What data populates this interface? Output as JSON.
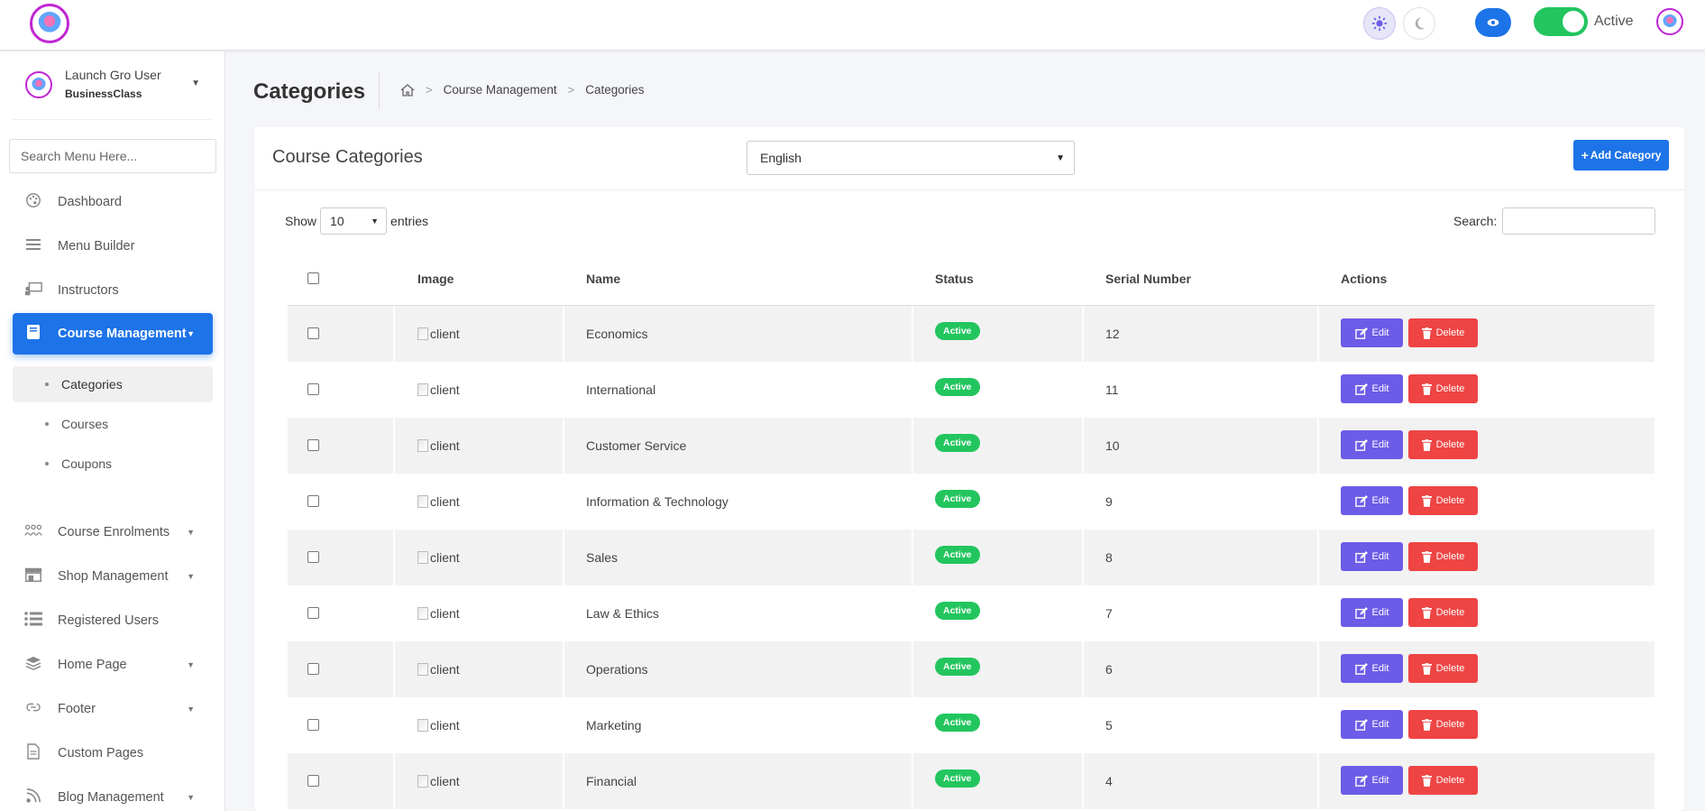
{
  "topbar": {
    "status_label": "Active",
    "icons": [
      "logo",
      "sun-icon",
      "moon-icon",
      "eye-icon",
      "toggle-switch",
      "avatar"
    ]
  },
  "sidebar": {
    "user_name": "Launch Gro User",
    "user_class": "BusinessClass",
    "search_placeholder": "Search Menu Here...",
    "items": [
      {
        "label": "Dashboard",
        "icon": "palette-icon"
      },
      {
        "label": "Menu Builder",
        "icon": "bars-icon"
      },
      {
        "label": "Instructors",
        "icon": "chalkboard-teacher-icon"
      },
      {
        "label": "Course Management",
        "icon": "book-icon"
      },
      {
        "label": "Course Enrolments",
        "icon": "users-icon"
      },
      {
        "label": "Shop Management",
        "icon": "store-icon"
      },
      {
        "label": "Registered Users",
        "icon": "list-icon"
      },
      {
        "label": "Home Page",
        "icon": "layers-icon"
      },
      {
        "label": "Footer",
        "icon": "link-icon"
      },
      {
        "label": "Custom Pages",
        "icon": "file-icon"
      },
      {
        "label": "Blog Management",
        "icon": "blog-icon"
      }
    ],
    "sub_items": [
      {
        "label": "Categories"
      },
      {
        "label": "Courses"
      },
      {
        "label": "Coupons"
      }
    ]
  },
  "page": {
    "title": "Categories",
    "breadcrumb": [
      "Course Management",
      "Categories"
    ]
  },
  "card": {
    "title": "Course Categories",
    "language": "English",
    "add_button": "Add Category",
    "show_label": "Show",
    "entries_value": "10",
    "entries_label": "entries",
    "search_label": "Search:"
  },
  "table": {
    "headers": {
      "image": "Image",
      "name": "Name",
      "status": "Status",
      "serial": "Serial Number",
      "actions": "Actions"
    },
    "edit_label": "Edit",
    "delete_label": "Delete",
    "rows": [
      {
        "image_alt": "client",
        "name": "Economics",
        "status": "Active",
        "serial": "12"
      },
      {
        "image_alt": "client",
        "name": "International",
        "status": "Active",
        "serial": "11"
      },
      {
        "image_alt": "client",
        "name": "Customer Service",
        "status": "Active",
        "serial": "10"
      },
      {
        "image_alt": "client",
        "name": "Information & Technology",
        "status": "Active",
        "serial": "9"
      },
      {
        "image_alt": "client",
        "name": "Sales",
        "status": "Active",
        "serial": "8"
      },
      {
        "image_alt": "client",
        "name": "Law & Ethics",
        "status": "Active",
        "serial": "7"
      },
      {
        "image_alt": "client",
        "name": "Operations",
        "status": "Active",
        "serial": "6"
      },
      {
        "image_alt": "client",
        "name": "Marketing",
        "status": "Active",
        "serial": "5"
      },
      {
        "image_alt": "client",
        "name": "Financial",
        "status": "Active",
        "serial": "4"
      }
    ]
  },
  "colors": {
    "primary": "#1d73e8",
    "edit": "#6c5ce7",
    "delete": "#ef4444",
    "active": "#22c55e"
  }
}
